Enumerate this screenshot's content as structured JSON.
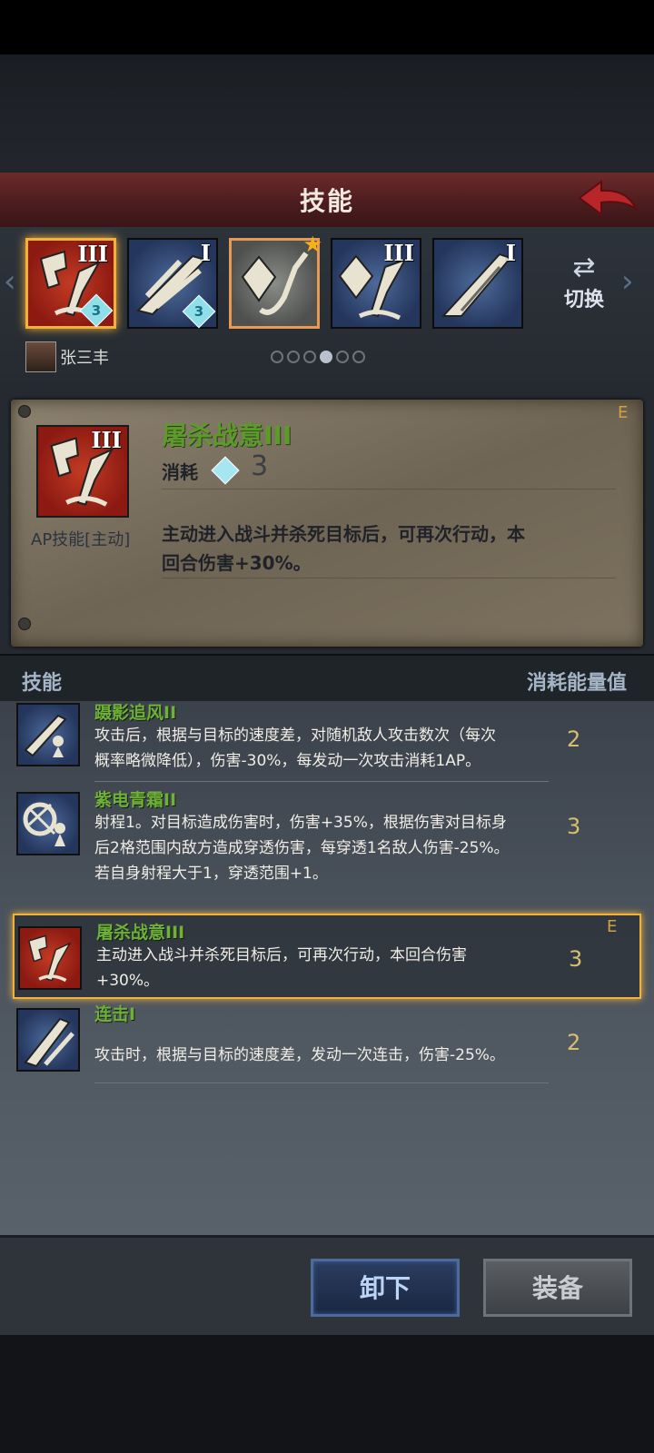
{
  "header": {
    "title": "技能"
  },
  "tabs": [
    {
      "roman": "III",
      "gem": "3",
      "bg": "red",
      "selected": true,
      "icon": "sword-fist-icon"
    },
    {
      "roman": "I",
      "gem": "3",
      "bg": "blue",
      "selected": false,
      "icon": "wind-claw-icon"
    },
    {
      "roman": "",
      "gem": "",
      "bg": "gray",
      "selected": false,
      "star": true,
      "icon": "crystal-spear-icon"
    },
    {
      "roman": "III",
      "gem": "",
      "bg": "blue",
      "selected": false,
      "icon": "crystal-sword-icon"
    },
    {
      "roman": "I",
      "gem": "",
      "bg": "blue",
      "selected": false,
      "icon": "double-blade-icon"
    }
  ],
  "swap_label": "切换",
  "hero_name": "张三丰",
  "page_dots": {
    "count": 6,
    "active": 4
  },
  "detail": {
    "name": "屠杀战意III",
    "roman": "III",
    "cost_label": "消耗",
    "cost": "3",
    "type": "AP技能[主动]",
    "rank": "E",
    "desc_line1": "主动进入战斗并杀死目标后，可再次行动，本",
    "desc_line2": "回合伤害+30%。"
  },
  "list_header": {
    "left": "技能",
    "right": "消耗能量值"
  },
  "skills": [
    {
      "name": "蹑影追风II",
      "lines": [
        "攻击后，根据与目标的速度差，对随机敌人攻击数次（每次",
        "概率略微降低），伤害-30%，每发动一次攻击消耗1AP。"
      ],
      "cost": "2"
    },
    {
      "name": "紫电青霜II",
      "lines": [
        "射程1。对目标造成伤害时，伤害+35%，根据伤害对目标身",
        "后2格范围内敌方造成穿透伤害，每穿透1名敌人伤害-25%。",
        "若自身射程大于1，穿透范围+1。"
      ],
      "cost": "3"
    },
    {
      "name": "屠杀战意III",
      "lines": [
        "主动进入战斗并杀死目标后，可再次行动，本回合伤害",
        "+30%。"
      ],
      "cost": "3",
      "rank": "E"
    },
    {
      "name": "连击I",
      "lines": [
        "攻击时，根据与目标的速度差，发动一次连击，伤害-25%。"
      ],
      "cost": "2"
    }
  ],
  "buttons": {
    "unequip": "卸下",
    "equip": "装备"
  },
  "colors": {
    "accent": "#f2b23a",
    "skill_name": "#6fb03a",
    "cost": "#d8bf6e"
  }
}
